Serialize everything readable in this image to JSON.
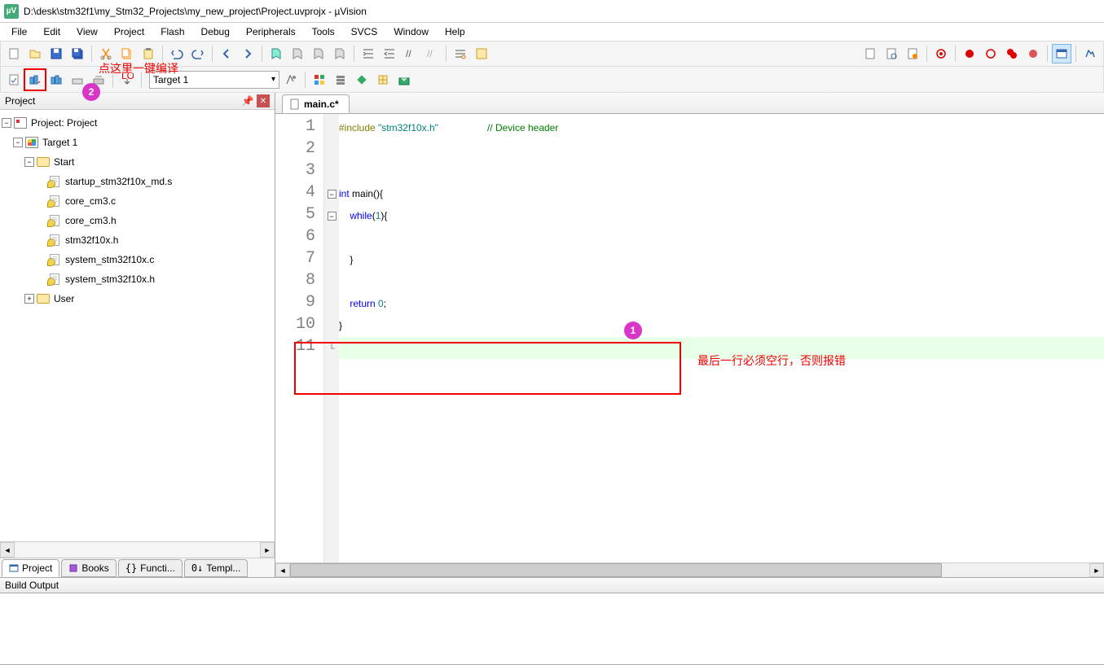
{
  "window": {
    "title": "D:\\desk\\stm32f1\\my_Stm32_Projects\\my_new_project\\Project.uvprojx - µVision",
    "app_abbrev": "µV"
  },
  "menu": [
    "File",
    "Edit",
    "View",
    "Project",
    "Flash",
    "Debug",
    "Peripherals",
    "Tools",
    "SVCS",
    "Window",
    "Help"
  ],
  "toolbar2": {
    "target": "Target 1"
  },
  "project_panel": {
    "title": "Project",
    "root": "Project: Project",
    "target": "Target 1",
    "groups": [
      {
        "name": "Start",
        "expanded": true,
        "files": [
          "startup_stm32f10x_md.s",
          "core_cm3.c",
          "core_cm3.h",
          "stm32f10x.h",
          "system_stm32f10x.c",
          "system_stm32f10x.h"
        ]
      },
      {
        "name": "User",
        "expanded": false,
        "files": []
      }
    ],
    "tabs": [
      "Project",
      "Books",
      "Functi...",
      "Templ..."
    ]
  },
  "editor": {
    "tab": "main.c*",
    "lines": [
      {
        "n": 1,
        "html": "<span class='pp'>#include</span> <span class='str'>\"stm32f10x.h\"</span>                  <span class='cmt'>// Device header</span>"
      },
      {
        "n": 2,
        "html": ""
      },
      {
        "n": 3,
        "html": ""
      },
      {
        "n": 4,
        "html": "<span class='kw'>int</span> main(){",
        "fold": "-"
      },
      {
        "n": 5,
        "html": "    <span class='kw'>while</span>(<span class='num'>1</span>){",
        "fold": "-"
      },
      {
        "n": 6,
        "html": ""
      },
      {
        "n": 7,
        "html": "    }"
      },
      {
        "n": 8,
        "html": ""
      },
      {
        "n": 9,
        "html": "    <span class='kw'>return</span> <span class='num'>0</span>;"
      },
      {
        "n": 10,
        "html": "}"
      },
      {
        "n": 11,
        "html": "",
        "hl": true,
        "fold": "L"
      }
    ]
  },
  "annotations": {
    "label_top": "点这里一键编译",
    "label_editor": "最后一行必须空行，否则报错",
    "badge1": "1",
    "badge2": "2"
  },
  "build": {
    "title": "Build Output"
  }
}
